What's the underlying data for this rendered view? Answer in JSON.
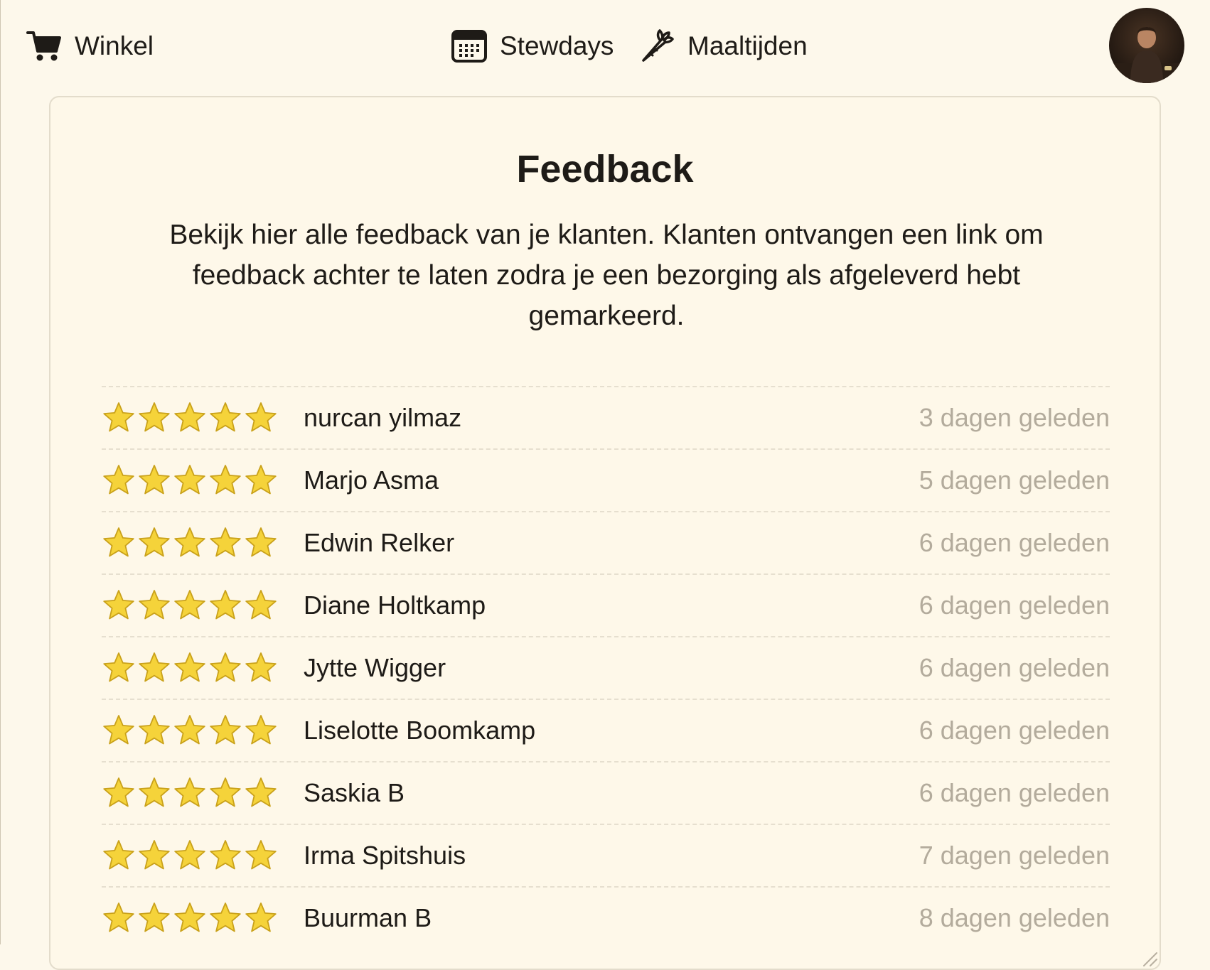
{
  "nav": {
    "winkel": {
      "label": "Winkel",
      "icon": "cart-icon"
    },
    "stewdays": {
      "label": "Stewdays",
      "icon": "calendar-icon"
    },
    "maaltijden": {
      "label": "Maaltijden",
      "icon": "carrot-icon"
    }
  },
  "feedback": {
    "title": "Feedback",
    "description": "Bekijk hier alle feedback van je klanten. Klanten ontvangen een link om feedback achter te laten zodra je een bezorging als afgeleverd hebt gemarkeerd.",
    "items": [
      {
        "rating": 5,
        "name": "nurcan yilmaz",
        "time": "3 dagen geleden"
      },
      {
        "rating": 5,
        "name": "Marjo Asma",
        "time": "5 dagen geleden"
      },
      {
        "rating": 5,
        "name": "Edwin Relker",
        "time": "6 dagen geleden"
      },
      {
        "rating": 5,
        "name": "Diane Holtkamp",
        "time": "6 dagen geleden"
      },
      {
        "rating": 5,
        "name": "Jytte Wigger",
        "time": "6 dagen geleden"
      },
      {
        "rating": 5,
        "name": "Liselotte Boomkamp",
        "time": "6 dagen geleden"
      },
      {
        "rating": 5,
        "name": "Saskia B",
        "time": "6 dagen geleden"
      },
      {
        "rating": 5,
        "name": "Irma Spitshuis",
        "time": "7 dagen geleden"
      },
      {
        "rating": 5,
        "name": "Buurman B",
        "time": "8 dagen geleden"
      }
    ]
  },
  "colors": {
    "background": "#fdf8eb",
    "star_fill": "#f5d33a",
    "star_stroke": "#c9a11a",
    "muted_text": "#b3ab9c"
  }
}
